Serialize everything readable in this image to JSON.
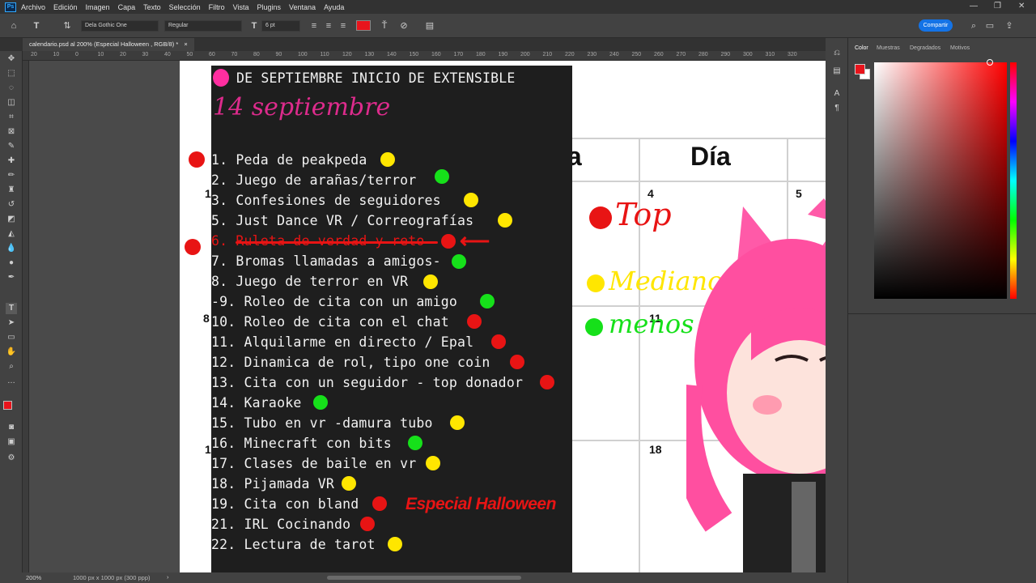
{
  "menu": {
    "logo": "Ps",
    "items": [
      "Archivo",
      "Edición",
      "Imagen",
      "Capa",
      "Texto",
      "Selección",
      "Filtro",
      "Vista",
      "Plugins",
      "Ventana",
      "Ayuda"
    ]
  },
  "options": {
    "font_family": "Dela Gothic One",
    "font_style": "Regular",
    "font_size": "6 pt",
    "text_color": "#e8141c",
    "share_label": "Compartir"
  },
  "document": {
    "tab_title": "calendario.psd al 200% (Especial Halloween , RGB/8) *",
    "close": "×"
  },
  "ruler_ticks": [
    "20",
    "10",
    "0",
    "10",
    "20",
    "30",
    "40",
    "50",
    "60",
    "70",
    "80",
    "90",
    "100",
    "110",
    "120",
    "130",
    "140",
    "150",
    "160",
    "170",
    "180",
    "190",
    "200",
    "210",
    "220",
    "230",
    "240",
    "250",
    "260",
    "270",
    "280",
    "290",
    "300",
    "310",
    "320"
  ],
  "status": {
    "zoom": "200%",
    "doc_info": "1000 px x 1000 px (300 ppp)"
  },
  "panel": {
    "tabs": [
      "Color",
      "Muestras",
      "Degradados",
      "Motivos"
    ],
    "fg_color": "#e8141c",
    "bg_color": "#ffffff"
  },
  "calendar": {
    "header_partial": "ía",
    "header_day": "Día",
    "day_numbers": [
      "4",
      "5",
      "11",
      "18"
    ],
    "side_numbers": [
      "1",
      "8",
      "1"
    ]
  },
  "legend": {
    "top": "Top",
    "medianos": "Medianos",
    "menos": "menos"
  },
  "note": {
    "header": "DE SEPTIEMBRE INICIO DE EXTENSIBLE",
    "date_scribble": "14 septiembre",
    "items": [
      "1. Peda de peakpeda",
      "2. Juego de arañas/terror",
      "3. Confesiones  de seguidores",
      "5. Just Dance VR /  Correografías",
      "6. Ruleta de verdad y reto",
      "7. Bromas llamadas a amigos-",
      "8. Juego de terror en VR",
      "-9. Roleo de cita con un amigo",
      "10. Roleo de cita con el chat",
      "11. Alquilarme en directo / Epal",
      "12. Dinamica de rol, tipo one coin",
      "13. Cita con un seguidor - top donador",
      "14. Karaoke",
      "15. Tubo en vr -damura tubo",
      "16. Minecraft con bits",
      "17. Clases de baile en vr",
      "18. Pijamada VR",
      "19. Cita con bland",
      "21. IRL Cocinando",
      "22. Lectura de tarot"
    ],
    "special": "Especial Halloween"
  },
  "colors": {
    "yellow": "#ffe600",
    "green": "#16e01a",
    "red": "#e81414",
    "pink": "#ff2ea0"
  }
}
